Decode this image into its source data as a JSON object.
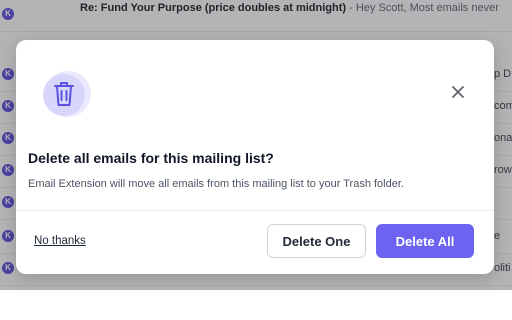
{
  "background": {
    "rows": [
      {
        "subject": "Re: Fund Your Purpose (price doubles at midnight)",
        "snippet": " - Hey Scott, Most emails never",
        "tail": ""
      },
      {
        "subject": "",
        "snippet": "",
        "tail": "p D"
      },
      {
        "subject": "",
        "snippet": "",
        "tail": "com"
      },
      {
        "subject": "",
        "snippet": "",
        "tail": "ona"
      },
      {
        "subject": "",
        "snippet": "",
        "tail": "row"
      },
      {
        "subject": "",
        "snippet": "",
        "tail": ""
      },
      {
        "subject": "",
        "snippet": "",
        "tail": "e"
      },
      {
        "subject": "",
        "snippet": "",
        "tail": "oliti"
      }
    ],
    "avatar_letter": "K"
  },
  "dialog": {
    "icon": "trash-icon",
    "close_icon": "close-icon",
    "title": "Delete all emails for this mailing list?",
    "message": "Email Extension will move all emails from this mailing list to your Trash folder.",
    "no_thanks_label": "No thanks",
    "delete_one_label": "Delete One",
    "delete_all_label": "Delete All"
  },
  "colors": {
    "accent": "#6c63f0",
    "icon_bg": "#d9d6fb",
    "icon_fg": "#5b52e0"
  }
}
